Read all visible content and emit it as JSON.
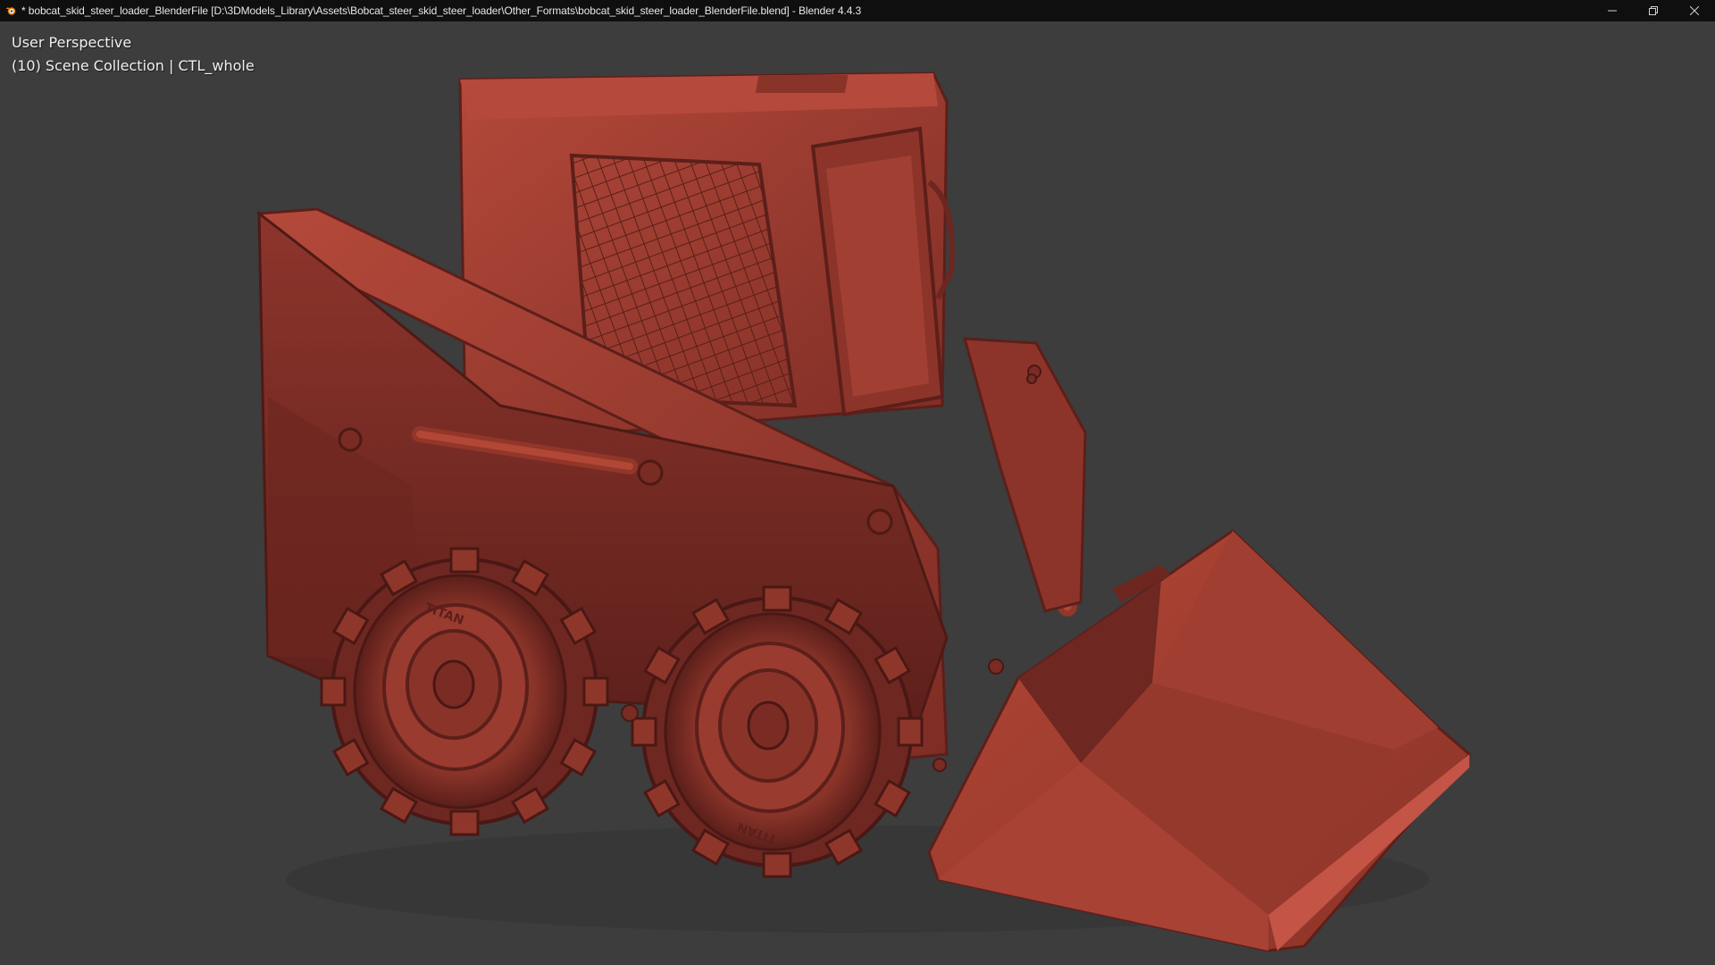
{
  "window": {
    "title": "* bobcat_skid_steer_loader_BlenderFile [D:\\3DModels_Library\\Assets\\Bobcat_steer_skid_steer_loader\\Other_Formats\\bobcat_skid_steer_loader_BlenderFile.blend] - Blender 4.4.3",
    "app_icon": "blender-logo-icon",
    "controls": {
      "minimize_icon": "minimize-icon",
      "restore_icon": "restore-icon",
      "close_icon": "close-icon"
    }
  },
  "viewport": {
    "view_name": "User Perspective",
    "collection_info": "(10) Scene Collection | CTL_whole",
    "background_color": "#3d3d3d",
    "model_color": "#9a3b30",
    "model_name": "bobcat skid steer loader",
    "tire_text": "TITAN"
  }
}
